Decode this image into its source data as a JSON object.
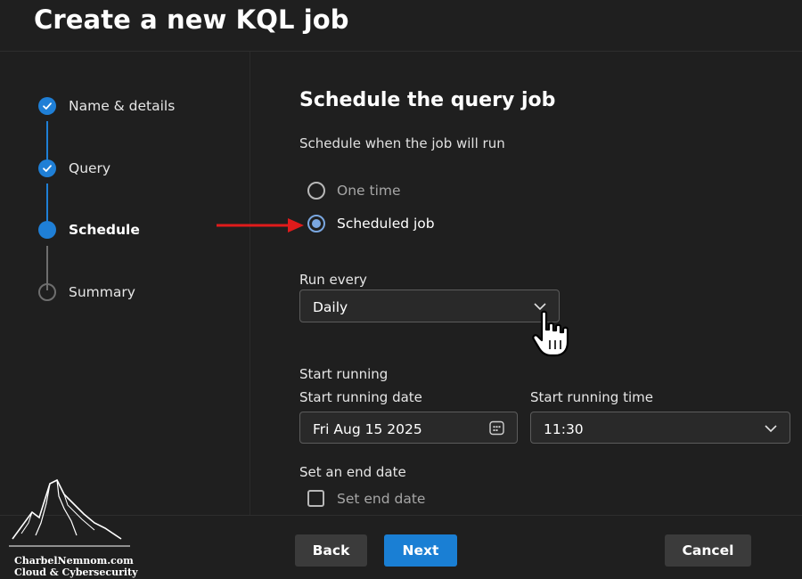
{
  "header": {
    "title": "Create a new KQL job"
  },
  "steps": [
    {
      "label": "Name & details",
      "state": "done"
    },
    {
      "label": "Query",
      "state": "done"
    },
    {
      "label": "Schedule",
      "state": "current"
    },
    {
      "label": "Summary",
      "state": "pending"
    }
  ],
  "main": {
    "title": "Schedule the query job",
    "subtitle": "Schedule when the job will run",
    "options": [
      {
        "label": "One time",
        "checked": false
      },
      {
        "label": "Scheduled job",
        "checked": true
      }
    ],
    "run_every": {
      "label": "Run every",
      "value": "Daily"
    },
    "start_running": {
      "label": "Start running",
      "date_label": "Start running date",
      "date_value": "Fri Aug 15 2025",
      "time_label": "Start running time",
      "time_value": "11:30"
    },
    "end_date": {
      "label": "Set an end date",
      "checkbox_label": "Set end date",
      "checked": false
    }
  },
  "footer": {
    "back": "Back",
    "next": "Next",
    "cancel": "Cancel"
  },
  "watermark": {
    "line1": "CharbelNemnom.com",
    "line2": "Cloud & Cybersecurity"
  },
  "colors": {
    "accent": "#1a7fd4",
    "radio_checked": "#7aa7e0",
    "arrow": "#e01b1b",
    "background": "#1f1f1f"
  },
  "icons": {
    "check": "checkmark-icon",
    "calendar": "calendar-icon",
    "chevron": "chevron-down-icon",
    "arrow": "red-arrow-icon",
    "cursor": "hand-pointer-icon",
    "logo": "mountain-logo-icon"
  }
}
